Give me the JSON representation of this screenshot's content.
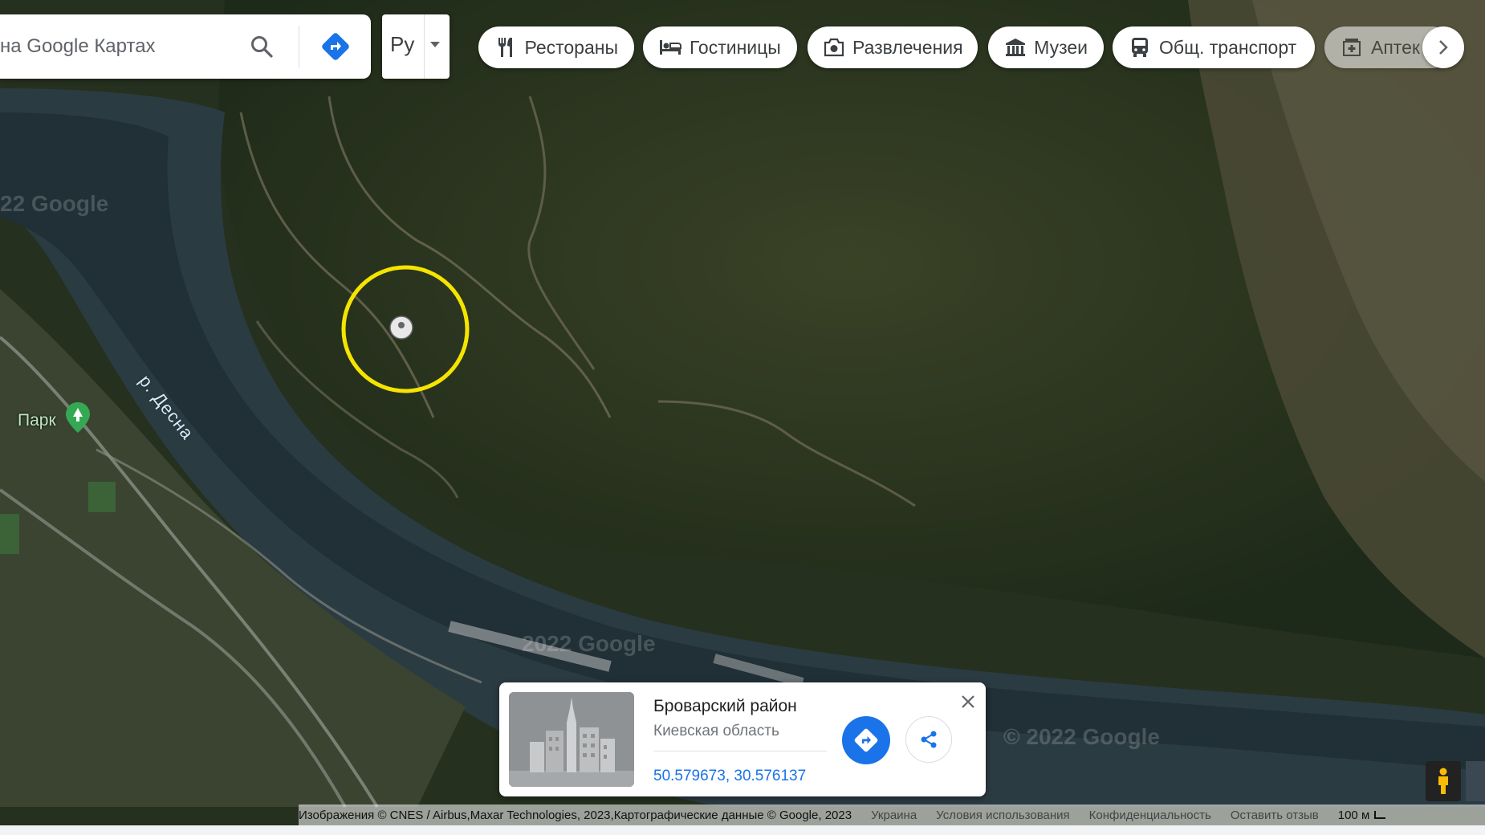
{
  "search": {
    "placeholder": "на Google Картах"
  },
  "language": {
    "selected": "Ру"
  },
  "categories": [
    {
      "label": "Рестораны",
      "icon": "restaurant-icon"
    },
    {
      "label": "Гостиницы",
      "icon": "hotel-icon"
    },
    {
      "label": "Развлечения",
      "icon": "camera-icon"
    },
    {
      "label": "Музеи",
      "icon": "museum-icon"
    },
    {
      "label": "Общ. транспорт",
      "icon": "bus-icon"
    },
    {
      "label": "Аптек",
      "icon": "pharmacy-icon"
    }
  ],
  "map": {
    "river_label": "р. Десна",
    "park_label": "Парк",
    "watermarks": [
      "22 Google",
      "2022 Google",
      "© 2022 Google"
    ],
    "highlight_color": "#f5e400"
  },
  "place_card": {
    "title": "Броварский район",
    "subtitle": "Киевская область",
    "coordinates": "50.579673, 30.576137"
  },
  "footer": {
    "attribution": "Изображения © CNES / Airbus,Maxar Technologies, 2023,Картографические данные © Google, 2023",
    "country": "Украина",
    "terms": "Условия использования",
    "privacy": "Конфиденциальность",
    "feedback": "Оставить отзыв",
    "scale": "100 м"
  },
  "colors": {
    "accent": "#1a73e8",
    "chip_text": "#3c4043"
  }
}
